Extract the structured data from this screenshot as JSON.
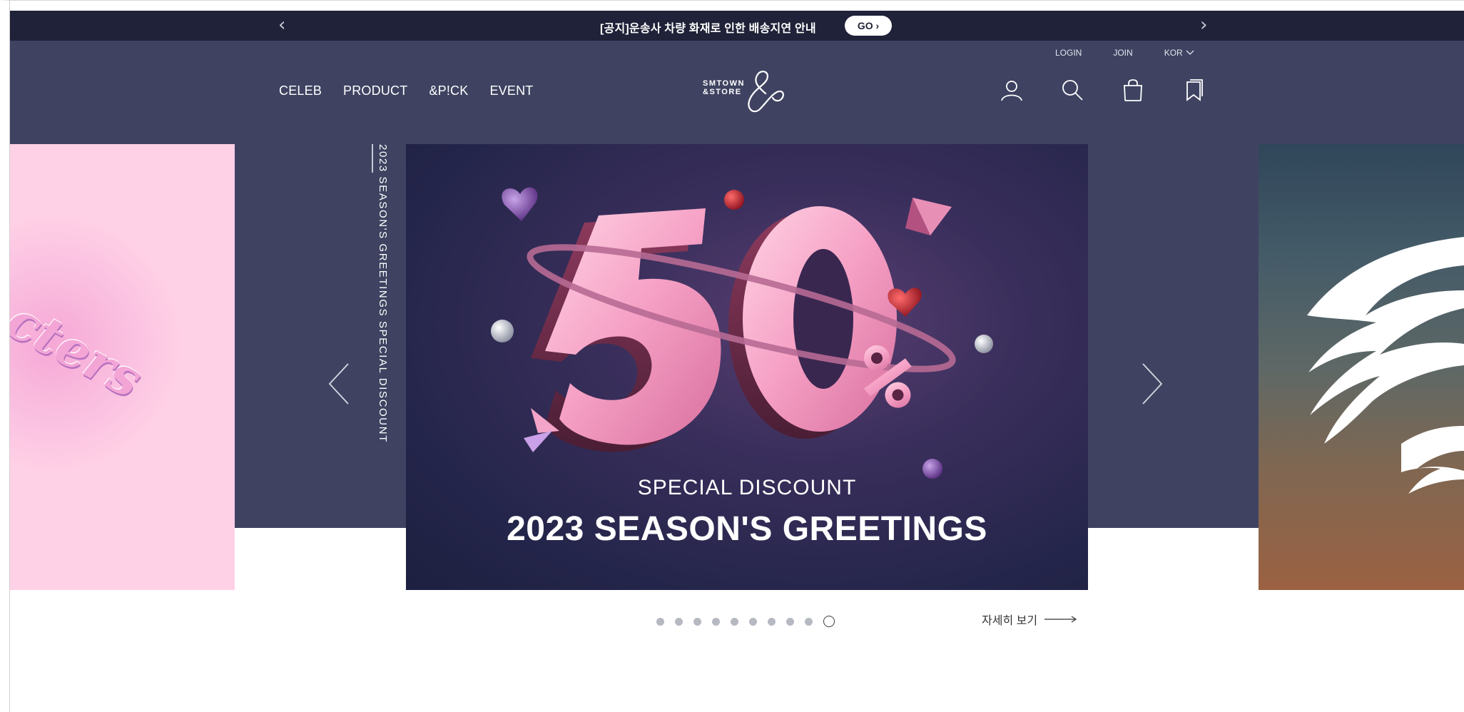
{
  "notice": {
    "text": "[공지]운송사 차량 화재로 인한 배송지연 안내",
    "go_label": "GO ›",
    "prev_glyph": "‹",
    "next_glyph": "›"
  },
  "header": {
    "util": [
      "LOGIN",
      "JOIN",
      "KOR"
    ],
    "nav": [
      "CELEB",
      "PRODUCT",
      "&P!CK",
      "EVENT"
    ],
    "logo_line1": "SMTOWN",
    "logo_line2": "&STORE",
    "icons": [
      "user-icon",
      "search-icon",
      "shopping-bag-icon",
      "bookmark-icon"
    ]
  },
  "carousel": {
    "vertical_caption": "2023 SEASON'S GREETINGS SPECIAL DISCOUNT",
    "main": {
      "badge": "50%",
      "subtitle": "SPECIAL DISCOUNT",
      "title": "2023 SEASON'S GREETINGS"
    },
    "left_slide_word": "cters",
    "dot_count": 10,
    "active_dot": 10,
    "more_label": "자세히 보기"
  },
  "colors": {
    "notice_bg": "#1f2238",
    "header_bg": "#3f4361",
    "pink_slide": "#ffd1e6",
    "accent_pink": "#f59fc4"
  }
}
